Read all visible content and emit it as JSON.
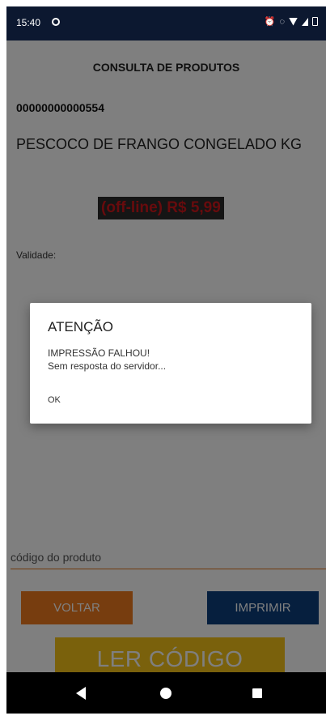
{
  "status_bar": {
    "time": "15:40",
    "icons_left": [
      "app-notification-icon"
    ],
    "icons_right": [
      "alarm-icon",
      "data-saver-icon",
      "wifi-icon",
      "signal-icon",
      "battery-icon"
    ]
  },
  "screen": {
    "title": "CONSULTA DE PRODUTOS",
    "product_code": "00000000000554",
    "product_name": "PESCOCO DE FRANGO CONGELADO KG",
    "price": "(off-line) R$ 5,99",
    "validade_label": "Validade:"
  },
  "product_input": {
    "placeholder": "código do produto",
    "value": ""
  },
  "buttons": {
    "voltar": "VOLTAR",
    "imprimir": "IMPRIMIR",
    "ler_codigo": "LER CÓDIGO"
  },
  "dialog": {
    "title": "ATENÇÃO",
    "message_lines": [
      "IMPRESSÃO FALHOU!",
      "Sem resposta do servidor..."
    ],
    "ok": "OK"
  },
  "navigation": {
    "back": "back-icon",
    "home": "home-icon",
    "recents": "recents-icon"
  },
  "colors": {
    "status_bar": "#0c1830",
    "voltar": "#ef7a1f",
    "imprimir": "#0d3f7c",
    "ler_codigo": "#f4c318",
    "price_text": "#d0161b",
    "price_bg": "#2a2a2a"
  }
}
